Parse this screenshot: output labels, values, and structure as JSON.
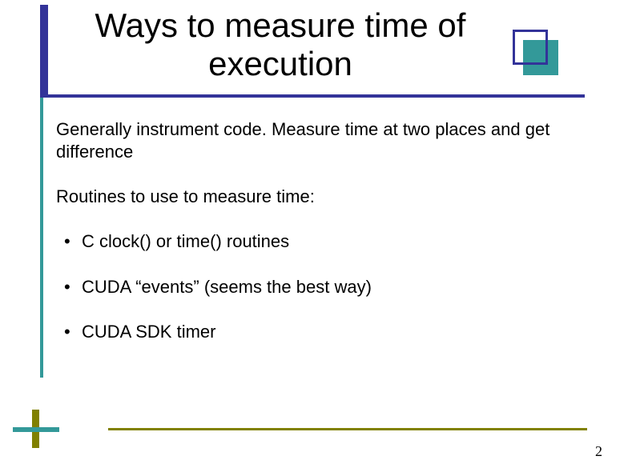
{
  "title": "Ways to measure time of execution",
  "body": {
    "intro": "Generally instrument code. Measure time at two places and get difference",
    "subhead": "Routines to use to measure time:",
    "bullets": [
      "C clock() or time() routines",
      "CUDA “events” (seems the best way)",
      "CUDA SDK timer"
    ]
  },
  "page_number": "2"
}
